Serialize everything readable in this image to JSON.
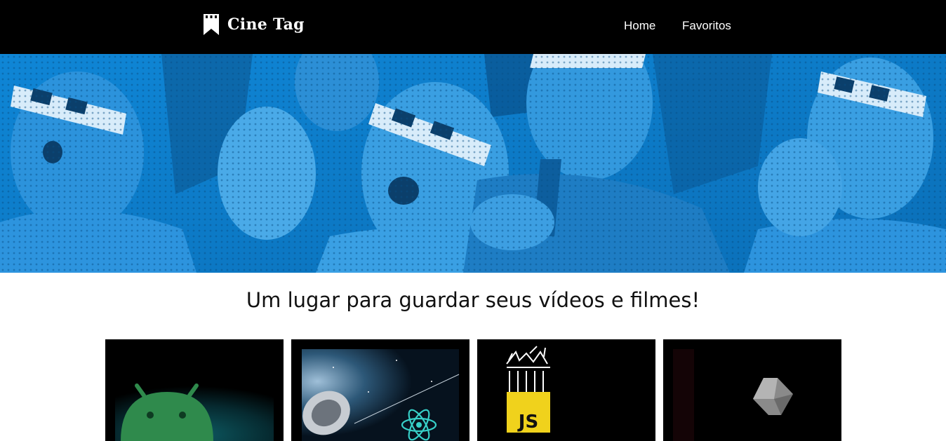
{
  "app": {
    "brand": "Cine Tag",
    "brand_icon": "bookmark-film-icon"
  },
  "nav": {
    "items": [
      {
        "label": "Home"
      },
      {
        "label": "Favoritos"
      }
    ]
  },
  "banner": {
    "description_icon": "cinema-audience-3d-glasses-image",
    "tint_color": "#0a78c8"
  },
  "main": {
    "headline": "Um lugar para guardar seus vídeos e filmes!"
  },
  "videos": [
    {
      "thumbnail": "android-logo-thumbnail",
      "badge_text": ""
    },
    {
      "thumbnail": "react-satellite-thumbnail",
      "badge_text": ""
    },
    {
      "thumbnail": "javascript-thumbnail",
      "badge_text": "JS"
    },
    {
      "thumbnail": "dart-logo-thumbnail",
      "badge_text": ""
    }
  ],
  "colors": {
    "header_bg": "#000000",
    "header_text": "#ffffff",
    "banner_blue": "#0a78c8",
    "js_yellow": "#f0d21c"
  }
}
